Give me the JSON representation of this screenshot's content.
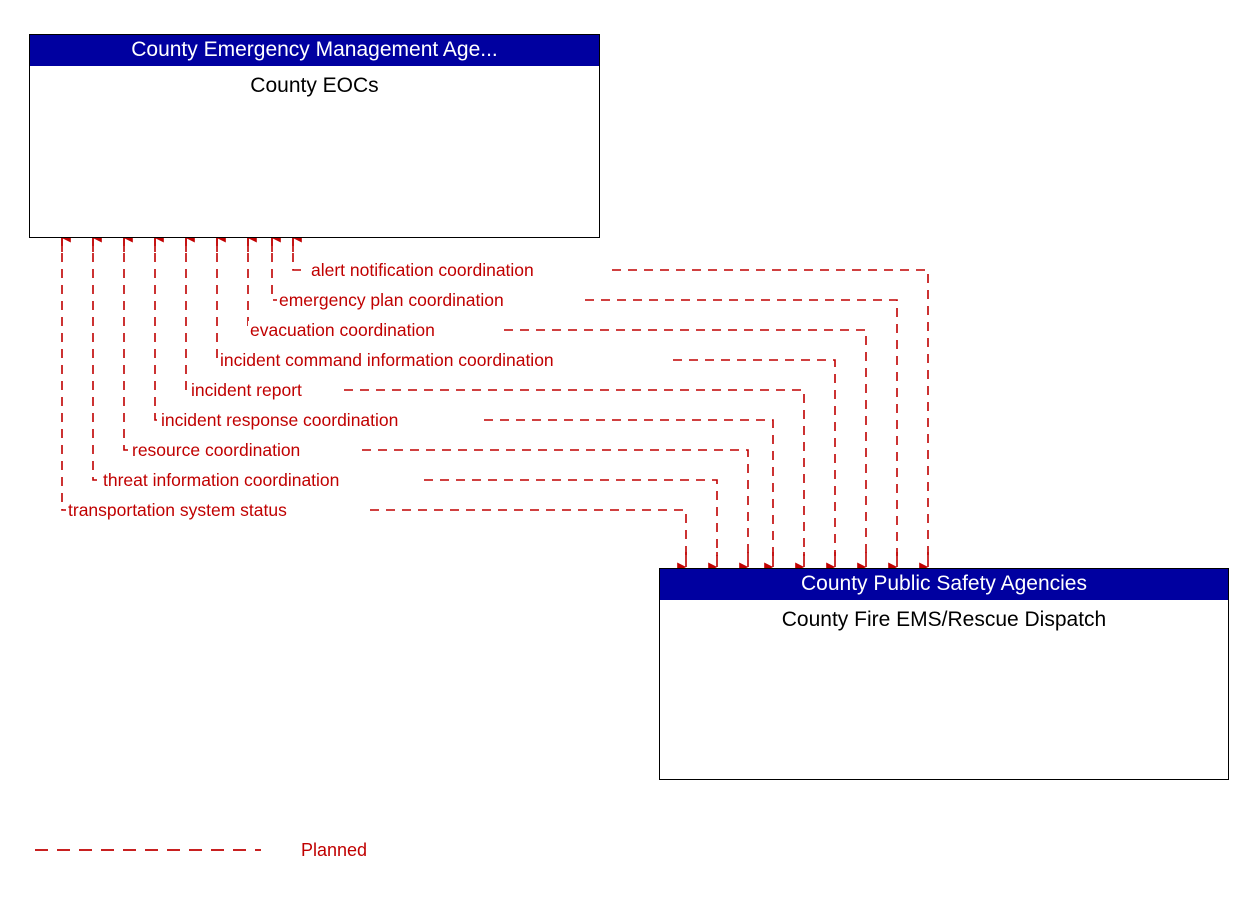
{
  "diagram": {
    "type": "architecture-interface-diagram",
    "colors": {
      "header_blue": "#0000A0",
      "flow_red": "#C00000",
      "box_border": "#000000",
      "background": "#FFFFFF"
    },
    "nodes": [
      {
        "id": "county-eocs",
        "stakeholder": "County Emergency Management Age...",
        "name": "County EOCs",
        "role": "destination"
      },
      {
        "id": "county-fire-ems-rescue-dispatch",
        "stakeholder": "County Public Safety Agencies",
        "name": "County Fire EMS/Rescue Dispatch",
        "role": "source"
      }
    ],
    "flows": [
      {
        "label": "alert notification coordination",
        "status": "Planned",
        "from": "county-fire-ems-rescue-dispatch",
        "to": "county-eocs"
      },
      {
        "label": "emergency plan coordination",
        "status": "Planned",
        "from": "county-fire-ems-rescue-dispatch",
        "to": "county-eocs"
      },
      {
        "label": "evacuation coordination",
        "status": "Planned",
        "from": "county-fire-ems-rescue-dispatch",
        "to": "county-eocs"
      },
      {
        "label": "incident command information coordination",
        "status": "Planned",
        "from": "county-fire-ems-rescue-dispatch",
        "to": "county-eocs"
      },
      {
        "label": "incident report",
        "status": "Planned",
        "from": "county-fire-ems-rescue-dispatch",
        "to": "county-eocs"
      },
      {
        "label": "incident response coordination",
        "status": "Planned",
        "from": "county-fire-ems-rescue-dispatch",
        "to": "county-eocs"
      },
      {
        "label": "resource coordination",
        "status": "Planned",
        "from": "county-fire-ems-rescue-dispatch",
        "to": "county-eocs"
      },
      {
        "label": "threat information coordination",
        "status": "Planned",
        "from": "county-fire-ems-rescue-dispatch",
        "to": "county-eocs"
      },
      {
        "label": "transportation system status",
        "status": "Planned",
        "from": "county-fire-ems-rescue-dispatch",
        "to": "county-eocs"
      }
    ],
    "legend": {
      "items": [
        {
          "label": "Planned",
          "style": "dashed",
          "color": "#C00000"
        }
      ]
    }
  }
}
